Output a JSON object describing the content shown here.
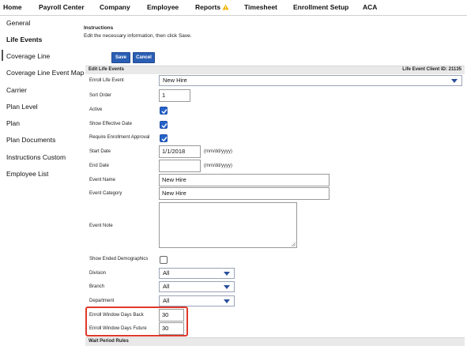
{
  "nav": {
    "items": [
      "Home",
      "Payroll Center",
      "Company",
      "Employee",
      "Reports",
      "Timesheet",
      "Enrollment Setup",
      "ACA"
    ],
    "reports_alert_icon": "warning-icon",
    "alert_color": "#f5b400"
  },
  "sidebar": {
    "items": [
      "General",
      "Life Events",
      "Coverage Line",
      "Coverage Line Event Map",
      "Carrier",
      "Plan Level",
      "Plan",
      "Plan Documents",
      "Instructions Custom",
      "Employee List"
    ],
    "active": "Life Events"
  },
  "instructions": {
    "title": "Instructions",
    "text": "Edit the necessary information, then click Save."
  },
  "buttons": {
    "save": "Save",
    "cancel": "Cancel"
  },
  "section": {
    "title": "Edit Life Events",
    "client_id": "Life Event Client ID: 21135"
  },
  "form": {
    "enroll_life_event": {
      "label": "Enroll Life Event",
      "value": "New Hire"
    },
    "sort_order": {
      "label": "Sort Order",
      "value": "1"
    },
    "active": {
      "label": "Active",
      "checked": true
    },
    "show_effective_date": {
      "label": "Show Effective Date",
      "checked": true
    },
    "require_enrollment_approval": {
      "label": "Require Enrollment Approval",
      "checked": true
    },
    "start_date": {
      "label": "Start Date",
      "value": "1/1/2018",
      "hint": "(mm/dd/yyyy)"
    },
    "end_date": {
      "label": "End Date",
      "value": "",
      "hint": "(mm/dd/yyyy)"
    },
    "event_name": {
      "label": "Event Name",
      "value": "New Hire"
    },
    "event_category": {
      "label": "Event Category",
      "value": "New Hire"
    },
    "event_note": {
      "label": "Event Note",
      "value": ""
    },
    "show_ended_demographics": {
      "label": "Show Ended Demographics",
      "checked": false
    },
    "division": {
      "label": "Division",
      "value": "All"
    },
    "branch": {
      "label": "Branch",
      "value": "All"
    },
    "department": {
      "label": "Department",
      "value": "All"
    },
    "enroll_window_days_back": {
      "label": "Enroll Window Days Back",
      "value": "30"
    },
    "enroll_window_days_future": {
      "label": "Enroll Window Days Future",
      "value": "30"
    }
  },
  "wait_period": {
    "title": "Wait Period Rules"
  },
  "colors": {
    "primary_button": "#2b5fb4",
    "checkbox": "#2563c9",
    "highlight": "#e0382b"
  }
}
